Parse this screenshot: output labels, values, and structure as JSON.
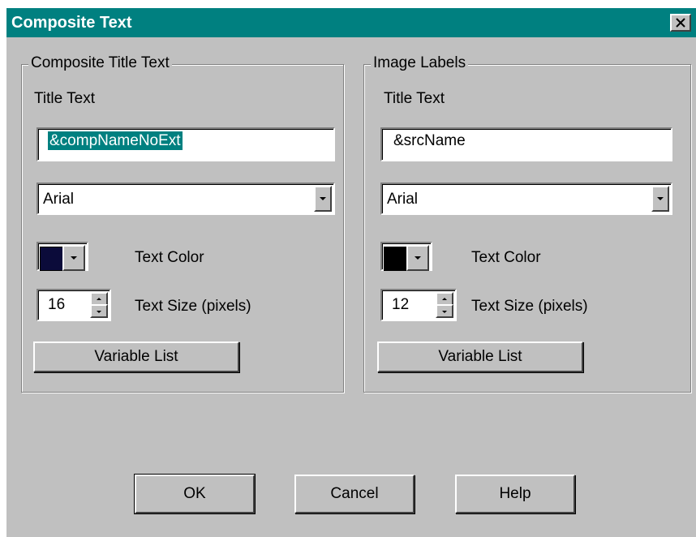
{
  "window": {
    "title": "Composite Text"
  },
  "groups": [
    {
      "label": "Composite Title Text",
      "title_text_label": "Title Text",
      "title_value": "&compNameNoExt",
      "font": "Arial",
      "color_label": "Text Color",
      "color": "#0b0b3a",
      "size_value": "16",
      "size_label": "Text Size (pixels)",
      "variable_button": "Variable List"
    },
    {
      "label": "Image Labels",
      "title_text_label": "Title Text",
      "title_value": "&srcName",
      "font": "Arial",
      "color_label": "Text Color",
      "color": "#000000",
      "size_value": "12",
      "size_label": "Text Size (pixels)",
      "variable_button": "Variable List"
    }
  ],
  "buttons": {
    "ok": "OK",
    "cancel": "Cancel",
    "help": "Help"
  },
  "colors": {
    "title_bar": "#008080",
    "dialog_bg": "#c0c0c0",
    "selection": "#008080"
  }
}
